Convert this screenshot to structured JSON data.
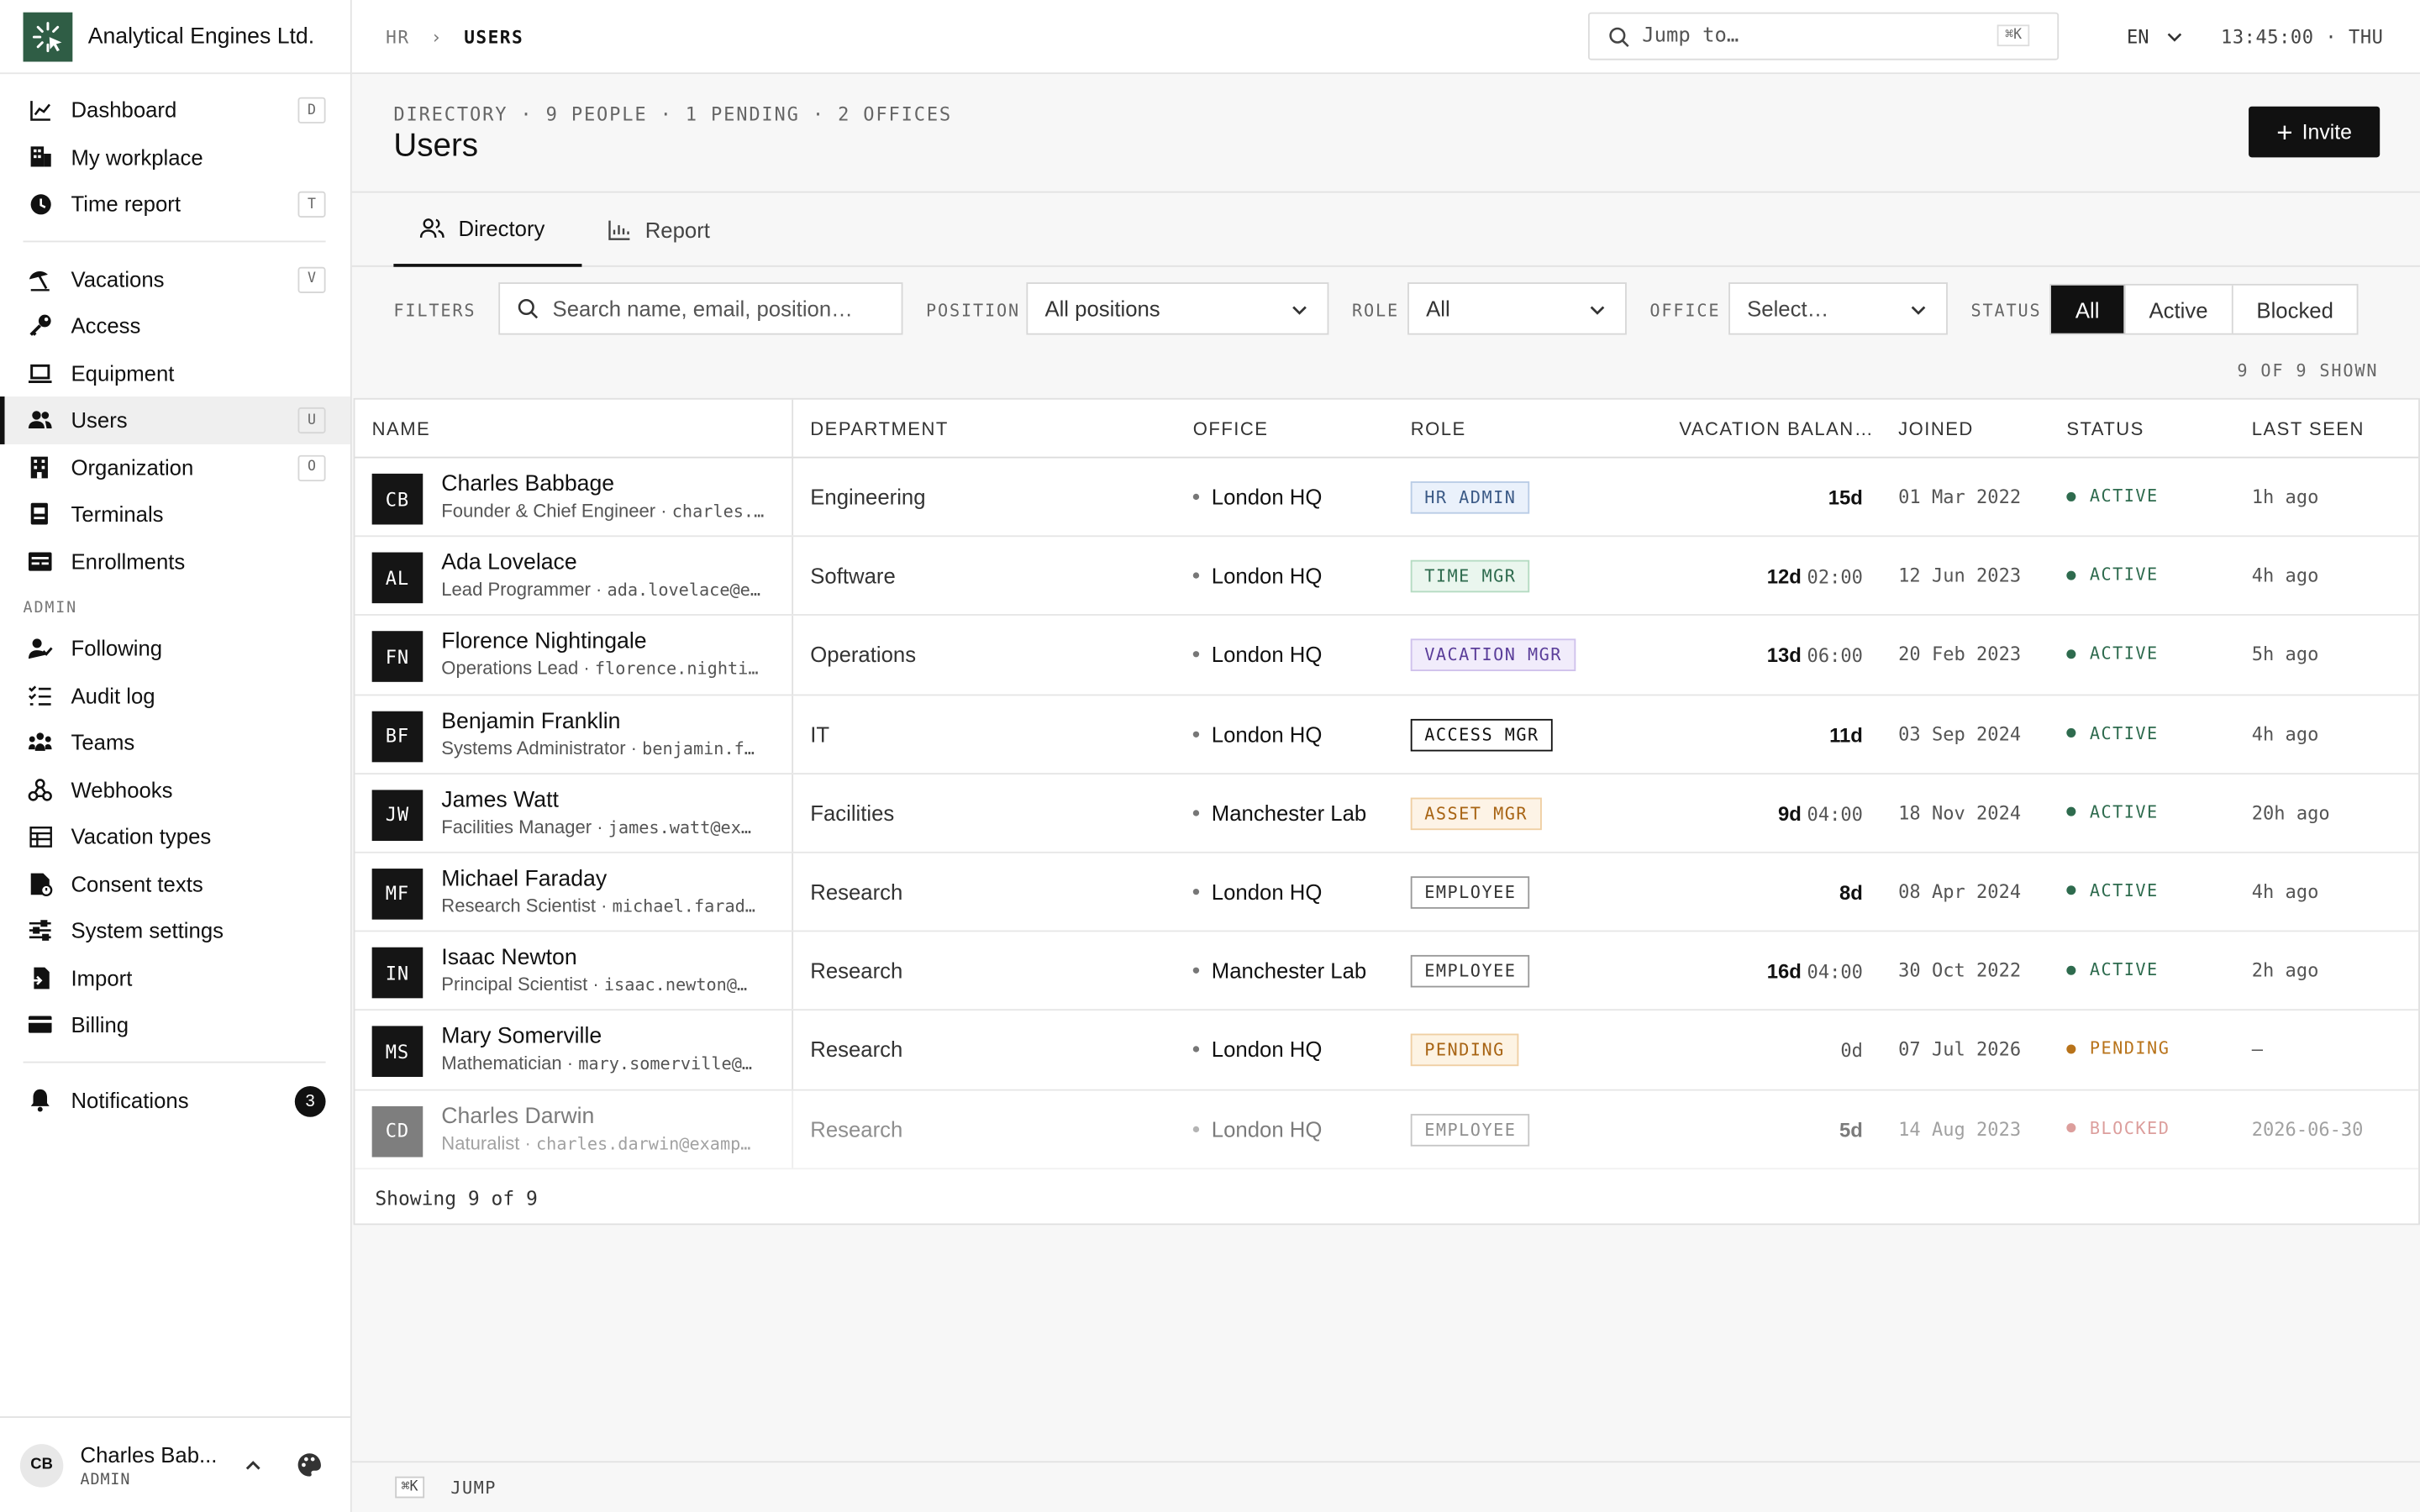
{
  "brand": {
    "name": "Analytical Engines Ltd."
  },
  "sidebar": {
    "group1": [
      {
        "label": "Dashboard",
        "icon": "chart-line-icon",
        "key": "D"
      },
      {
        "label": "My workplace",
        "icon": "building-icon",
        "key": ""
      },
      {
        "label": "Time report",
        "icon": "clock-icon",
        "key": "T"
      }
    ],
    "group2": [
      {
        "label": "Vacations",
        "icon": "umbrella-icon",
        "key": "V"
      },
      {
        "label": "Access",
        "icon": "key-icon",
        "key": ""
      },
      {
        "label": "Equipment",
        "icon": "laptop-icon",
        "key": ""
      },
      {
        "label": "Users",
        "icon": "users-icon",
        "key": "U"
      },
      {
        "label": "Organization",
        "icon": "building-icon",
        "key": "O"
      },
      {
        "label": "Terminals",
        "icon": "terminal-icon",
        "key": ""
      },
      {
        "label": "Enrollments",
        "icon": "id-card-icon",
        "key": ""
      }
    ],
    "admin_label": "ADMIN",
    "admin": [
      {
        "label": "Following",
        "icon": "user-check-icon"
      },
      {
        "label": "Audit log",
        "icon": "list-check-icon"
      },
      {
        "label": "Teams",
        "icon": "team-icon"
      },
      {
        "label": "Webhooks",
        "icon": "webhook-icon"
      },
      {
        "label": "Vacation types",
        "icon": "table-icon"
      },
      {
        "label": "Consent texts",
        "icon": "document-icon"
      },
      {
        "label": "System settings",
        "icon": "sliders-icon"
      },
      {
        "label": "Import",
        "icon": "file-import-icon"
      },
      {
        "label": "Billing",
        "icon": "credit-card-icon"
      }
    ],
    "notifications": {
      "label": "Notifications",
      "count": "3"
    },
    "user": {
      "initials": "CB",
      "name": "Charles Bab...",
      "role": "ADMIN"
    }
  },
  "topbar": {
    "crumb_parent": "HR",
    "crumb_sep": "›",
    "crumb_current": "USERS",
    "jump_placeholder": "Jump to…",
    "jump_key": "⌘K",
    "lang": "EN",
    "clock": "13:45:00 · THU"
  },
  "header": {
    "meta": "DIRECTORY · 9 PEOPLE · 1 PENDING · 2 OFFICES",
    "title": "Users",
    "invite_label": "Invite"
  },
  "tabs": [
    {
      "label": "Directory"
    },
    {
      "label": "Report"
    }
  ],
  "filters": {
    "label": "FILTERS",
    "search_placeholder": "Search name, email, position…",
    "position_label": "POSITION",
    "position_value": "All positions",
    "role_label": "ROLE",
    "role_value": "All",
    "office_label": "OFFICE",
    "office_value": "Select…",
    "status_label": "STATUS",
    "status_options": [
      "All",
      "Active",
      "Blocked"
    ],
    "status_selected": "All"
  },
  "shown": "9 OF 9 SHOWN",
  "table": {
    "columns": [
      "NAME",
      "DEPARTMENT",
      "OFFICE",
      "ROLE",
      "VACATION BALAN…",
      "JOINED",
      "STATUS",
      "LAST SEEN"
    ],
    "rows": [
      {
        "initials": "CB",
        "name": "Charles Babbage",
        "position": "Founder & Chief Engineer ·",
        "email": "charles.…",
        "dept": "Engineering",
        "office": "London HQ",
        "role": "HR ADMIN",
        "role_style": "hr",
        "vac_days": "15d",
        "vac_hours": "",
        "joined": "01 Mar 2022",
        "status": "ACTIVE",
        "status_style": "active",
        "seen": "1h ago"
      },
      {
        "initials": "AL",
        "name": "Ada Lovelace",
        "position": "Lead Programmer ·",
        "email": "ada.lovelace@e…",
        "dept": "Software",
        "office": "London HQ",
        "role": "TIME MGR",
        "role_style": "time",
        "vac_days": "12d",
        "vac_hours": "02:00",
        "joined": "12 Jun 2023",
        "status": "ACTIVE",
        "status_style": "active",
        "seen": "4h ago"
      },
      {
        "initials": "FN",
        "name": "Florence Nightingale",
        "position": "Operations Lead ·",
        "email": "florence.nighti…",
        "dept": "Operations",
        "office": "London HQ",
        "role": "VACATION MGR",
        "role_style": "vac",
        "vac_days": "13d",
        "vac_hours": "06:00",
        "joined": "20 Feb 2023",
        "status": "ACTIVE",
        "status_style": "active",
        "seen": "5h ago"
      },
      {
        "initials": "BF",
        "name": "Benjamin Franklin",
        "position": "Systems Administrator ·",
        "email": "benjamin.f…",
        "dept": "IT",
        "office": "London HQ",
        "role": "ACCESS MGR",
        "role_style": "access",
        "vac_days": "11d",
        "vac_hours": "",
        "joined": "03 Sep 2024",
        "status": "ACTIVE",
        "status_style": "active",
        "seen": "4h ago"
      },
      {
        "initials": "JW",
        "name": "James Watt",
        "position": "Facilities Manager ·",
        "email": "james.watt@ex…",
        "dept": "Facilities",
        "office": "Manchester Lab",
        "role": "ASSET MGR",
        "role_style": "asset",
        "vac_days": "9d",
        "vac_hours": "04:00",
        "joined": "18 Nov 2024",
        "status": "ACTIVE",
        "status_style": "active",
        "seen": "20h ago"
      },
      {
        "initials": "MF",
        "name": "Michael Faraday",
        "position": "Research Scientist ·",
        "email": "michael.farad…",
        "dept": "Research",
        "office": "London HQ",
        "role": "EMPLOYEE",
        "role_style": "emp",
        "vac_days": "8d",
        "vac_hours": "",
        "joined": "08 Apr 2024",
        "status": "ACTIVE",
        "status_style": "active",
        "seen": "4h ago"
      },
      {
        "initials": "IN",
        "name": "Isaac Newton",
        "position": "Principal Scientist ·",
        "email": "isaac.newton@…",
        "dept": "Research",
        "office": "Manchester Lab",
        "role": "EMPLOYEE",
        "role_style": "emp",
        "vac_days": "16d",
        "vac_hours": "04:00",
        "joined": "30 Oct 2022",
        "status": "ACTIVE",
        "status_style": "active",
        "seen": "2h ago"
      },
      {
        "initials": "MS",
        "name": "Mary Somerville",
        "position": "Mathematician ·",
        "email": "mary.somerville@…",
        "dept": "Research",
        "office": "London HQ",
        "role": "PENDING",
        "role_style": "pending",
        "vac_days": "0d",
        "vac_hours": "",
        "joined": "07 Jul 2026",
        "status": "PENDING",
        "status_style": "pending",
        "seen": "–"
      },
      {
        "initials": "CD",
        "name": "Charles Darwin",
        "position": "Naturalist ·",
        "email": "charles.darwin@examp…",
        "dept": "Research",
        "office": "London HQ",
        "role": "EMPLOYEE",
        "role_style": "emp",
        "vac_days": "5d",
        "vac_hours": "",
        "joined": "14 Aug 2023",
        "status": "BLOCKED",
        "status_style": "blocked",
        "seen": "2026-06-30"
      }
    ],
    "footer": "Showing 9 of 9"
  },
  "bottombar": {
    "key": "⌘K",
    "label": "JUMP"
  },
  "colors": {
    "brand": "#2f5d45",
    "active": "#2e6b4e",
    "pending": "#b8731a",
    "blocked": "#c0504d"
  }
}
